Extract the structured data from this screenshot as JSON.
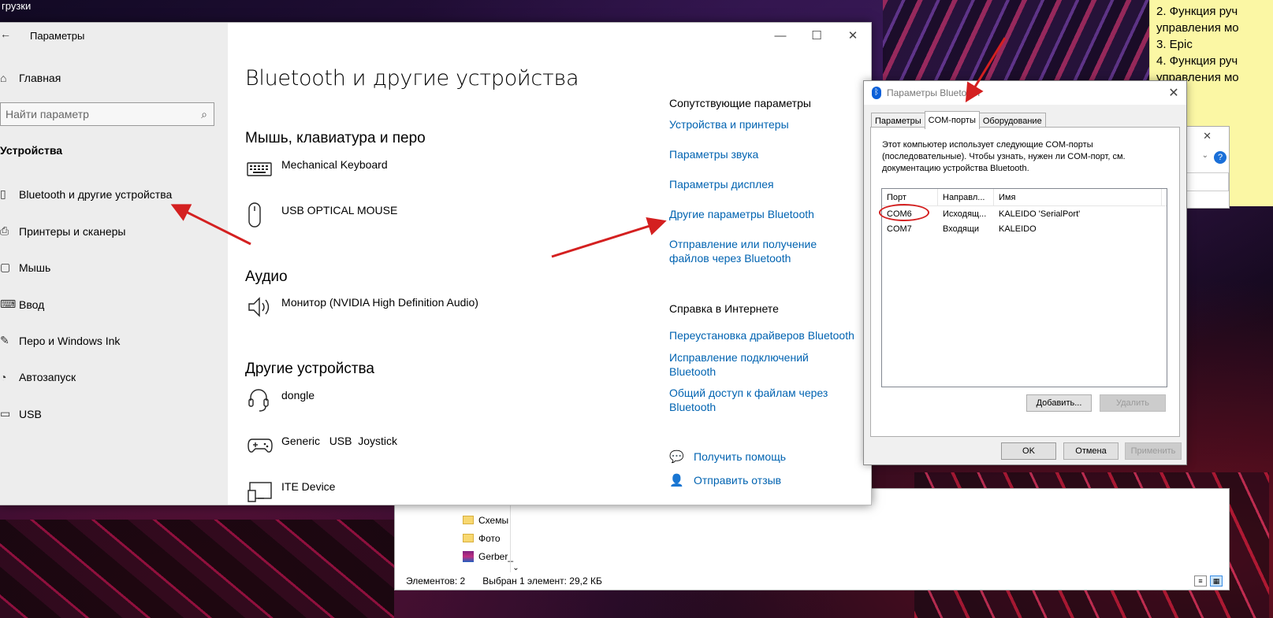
{
  "desktop": {
    "top_left_text": "грузки"
  },
  "sticky_note": {
    "lines": [
      "2. Функция руч",
      "управления мо",
      "3. Epic",
      "4. Функция руч",
      "управления мо"
    ]
  },
  "settings": {
    "window_title": "Параметры",
    "controls": {
      "minimize": "—",
      "maximize": "☐",
      "close": "✕"
    },
    "sidebar": {
      "home_label": "Главная",
      "search_placeholder": "Найти параметр",
      "section_label": "Устройства",
      "items": [
        {
          "label": "Bluetooth и другие устройства",
          "icon": "bluetooth-devices-icon"
        },
        {
          "label": "Принтеры и сканеры",
          "icon": "printer-icon"
        },
        {
          "label": "Мышь",
          "icon": "mouse-icon"
        },
        {
          "label": "Ввод",
          "icon": "keyboard-icon"
        },
        {
          "label": "Перо и Windows Ink",
          "icon": "pen-icon"
        },
        {
          "label": "Автозапуск",
          "icon": "autoplay-icon"
        },
        {
          "label": "USB",
          "icon": "usb-icon"
        }
      ]
    },
    "main": {
      "page_title": "Bluetooth и другие устройства",
      "groups": [
        {
          "title": "Мышь, клавиатура и перо",
          "devices": [
            {
              "name": "Mechanical Keyboard",
              "icon": "keyboard-icon"
            },
            {
              "name": "USB OPTICAL MOUSE",
              "icon": "mouse-icon"
            }
          ]
        },
        {
          "title": "Аудио",
          "devices": [
            {
              "name": "Монитор (NVIDIA High Definition Audio)",
              "icon": "speaker-icon"
            }
          ]
        },
        {
          "title": "Другие устройства",
          "devices": [
            {
              "name": "dongle",
              "icon": "headset-icon"
            },
            {
              "name": "Generic   USB  Joystick",
              "icon": "gamepad-icon"
            },
            {
              "name": "ITE Device",
              "icon": "display-device-icon"
            }
          ]
        }
      ]
    },
    "related": {
      "heading": "Сопутствующие параметры",
      "links": [
        "Устройства и принтеры",
        "Параметры звука",
        "Параметры дисплея",
        "Другие параметры Bluetooth",
        "Отправление или получение файлов через Bluetooth"
      ],
      "help_heading": "Справка в Интернете",
      "help_links": [
        "Переустановка драйверов Bluetooth",
        "Исправление подключений Bluetooth",
        "Общий доступ к файлам через Bluetooth"
      ],
      "get_help": "Получить помощь",
      "feedback": "Отправить отзыв"
    }
  },
  "explorer": {
    "items": [
      {
        "name": "Схемы",
        "type": "folder"
      },
      {
        "name": "Фото",
        "type": "folder"
      },
      {
        "name": "Gerber_",
        "type": "archive"
      }
    ],
    "status_count": "Элементов: 2",
    "status_selected": "Выбран 1 элемент: 29,2 КБ"
  },
  "bt_dialog": {
    "title": "Параметры Bluetooth",
    "tabs": [
      "Параметры",
      "COM-порты",
      "Оборудование"
    ],
    "active_tab": "COM-порты",
    "description": "Этот компьютер использует следующие COM-порты (последовательные). Чтобы узнать, нужен ли COM-порт, см. документацию устройства Bluetooth.",
    "columns": [
      "Порт",
      "Направл...",
      "Имя"
    ],
    "rows": [
      {
        "port": "COM6",
        "direction": "Исходящ...",
        "name": "KALEIDO 'SerialPort'"
      },
      {
        "port": "COM7",
        "direction": "Входящи",
        "name": "KALEIDO"
      }
    ],
    "add_button": "Добавить...",
    "remove_button": "Удалить",
    "ok_button": "OK",
    "cancel_button": "Отмена",
    "apply_button": "Применить"
  },
  "colors": {
    "link": "#0063b1",
    "annotation_red": "#d42020"
  }
}
